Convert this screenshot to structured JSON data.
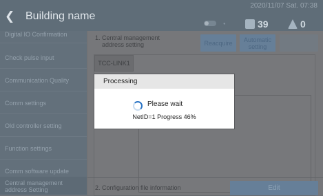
{
  "header": {
    "title": "Building name",
    "datetime": "2020/11/07 Sat. 07:38",
    "power_count": "39",
    "alert_count": "0"
  },
  "sidebar": {
    "items": [
      {
        "label": "Digital IO Confirmation"
      },
      {
        "label": "Check pulse input"
      },
      {
        "label": "Communication Quality"
      },
      {
        "label": "Comm settings"
      },
      {
        "label": "Old controller setting"
      },
      {
        "label": "Function settings"
      },
      {
        "label": "Comm software update"
      },
      {
        "label": "Central management\naddress Setting"
      }
    ]
  },
  "main": {
    "section1_label": "1. Central management\n    address setting",
    "reacquire_label": "Reacquire",
    "automatic_label": "Automatic\nsetting",
    "tab_label": "TCC-LINK1",
    "section2_label": "2. Configuration file information",
    "edit_label": "Edit"
  },
  "dialog": {
    "title": "Processing",
    "message": "Please wait",
    "progress_text": "NetID=1  Progress 46%"
  },
  "colors": {
    "header_bg": "#5f6d78",
    "dialog_spinner": "#2a74c5",
    "button_bg": "#667f98"
  }
}
